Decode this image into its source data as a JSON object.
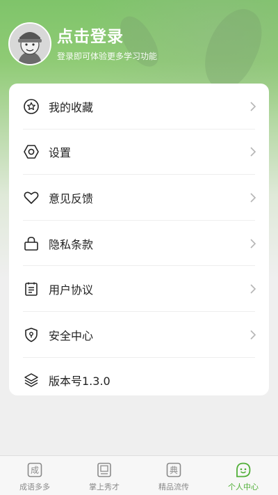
{
  "header": {
    "login_title": "点击登录",
    "login_subtitle": "登录即可体验更多学习功能"
  },
  "menu": {
    "items": [
      {
        "label": "我的收藏",
        "icon": "star-badge-icon"
      },
      {
        "label": "设置",
        "icon": "hexagon-settings-icon"
      },
      {
        "label": "意见反馈",
        "icon": "heart-icon"
      },
      {
        "label": "隐私条款",
        "icon": "lock-bag-icon"
      },
      {
        "label": "用户协议",
        "icon": "document-list-icon"
      },
      {
        "label": "安全中心",
        "icon": "shield-icon"
      },
      {
        "label": "版本号1.3.0",
        "icon": "layers-icon"
      }
    ]
  },
  "tabbar": {
    "tabs": [
      {
        "label": "成语多多",
        "glyph": "成",
        "icon": "idiom-tile-icon"
      },
      {
        "label": "掌上秀才",
        "glyph": "",
        "icon": "book-icon"
      },
      {
        "label": "精品流传",
        "glyph": "典",
        "icon": "classic-tile-icon"
      },
      {
        "label": "个人中心",
        "glyph": "",
        "icon": "smiley-bubble-icon"
      }
    ],
    "active": "个人中心",
    "active_color": "#4fae36"
  }
}
